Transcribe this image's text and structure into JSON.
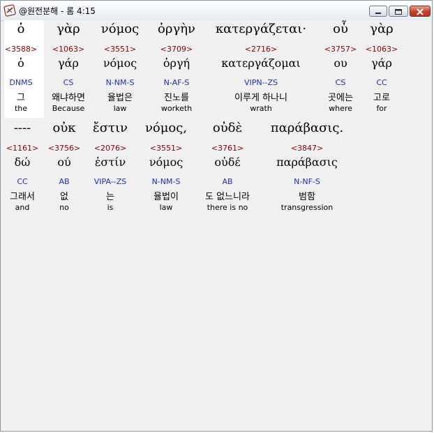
{
  "window": {
    "title": "@원전분해 - 롬 4:15"
  },
  "icons": {
    "app": "app-icon",
    "minimize": "minimize-icon",
    "maximize": "maximize-icon",
    "close": "close-icon"
  },
  "rows": [
    {
      "words": [
        {
          "greek": "ὁ",
          "strong": "<3588>",
          "lex": "ὁ",
          "morph": "DNMS",
          "korean": "그",
          "english": "the"
        },
        {
          "greek": "γὰρ",
          "strong": "<1063>",
          "lex": "γάρ",
          "morph": "CS",
          "korean": "왜냐하면",
          "english": "Because"
        },
        {
          "greek": "νόμος",
          "strong": "<3551>",
          "lex": "νόμος",
          "morph": "N-NM-S",
          "korean": "율법은",
          "english": "law"
        },
        {
          "greek": "ὀργὴν",
          "strong": "<3709>",
          "lex": "ὀργή",
          "morph": "N-AF-S",
          "korean": "진노를",
          "english": "worketh"
        },
        {
          "greek": "κατεργάζεται·",
          "strong": "<2716>",
          "lex": "κατεργάζομαι",
          "morph": "VIPN--ZS",
          "korean": "이루게 하나니",
          "english": "wrath"
        },
        {
          "greek": "οὗ",
          "strong": "<3757>",
          "lex": "ου",
          "morph": "CS",
          "korean": "곳에는",
          "english": "where"
        },
        {
          "greek": "γὰρ",
          "strong": "<1063>",
          "lex": "γάρ",
          "morph": "CC",
          "korean": "고로",
          "english": "for"
        }
      ]
    },
    {
      "words": [
        {
          "greek": "----",
          "strong": "<1161>",
          "lex": "δώ",
          "morph": "CC",
          "korean": "그래서",
          "english": "and"
        },
        {
          "greek": "οὐκ",
          "strong": "<3756>",
          "lex": "ού",
          "morph": "AB",
          "korean": "없",
          "english": "no"
        },
        {
          "greek": "ἔστιν",
          "strong": "<2076>",
          "lex": "ἐστίν",
          "morph": "VIPA--ZS",
          "korean": "는",
          "english": "is"
        },
        {
          "greek": "νόμος,",
          "strong": "<3551>",
          "lex": "νόμος",
          "morph": "N-NM-S",
          "korean": "율법이",
          "english": "law"
        },
        {
          "greek": "οὐδὲ",
          "strong": "<3761>",
          "lex": "οὐδέ",
          "morph": "AB",
          "korean": "도 없느니라",
          "english": "there is no"
        },
        {
          "greek": "παράβασις.",
          "strong": "<3847>",
          "lex": "παράβασις",
          "morph": "N-NF-S",
          "korean": "범함",
          "english": "transgression"
        }
      ]
    }
  ]
}
